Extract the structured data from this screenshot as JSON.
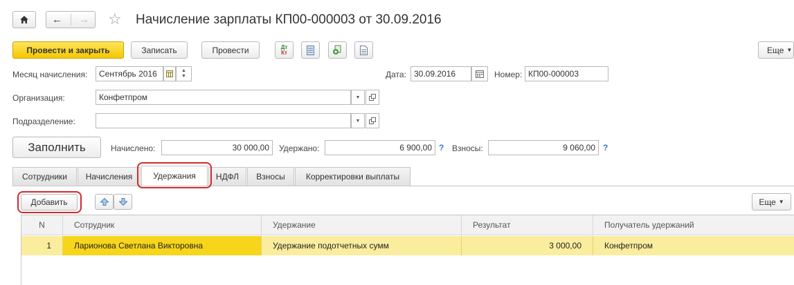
{
  "title": "Начисление зарплаты КП00-000003 от 30.09.2016",
  "toolbar": {
    "post_close": "Провести и закрыть",
    "save": "Записать",
    "post": "Провести",
    "more": "Еще"
  },
  "fields": {
    "month_label": "Месяц начисления:",
    "month_value": "Сентябрь 2016",
    "date_label": "Дата:",
    "date_value": "30.09.2016",
    "number_label": "Номер:",
    "number_value": "КП00-000003",
    "org_label": "Организация:",
    "org_value": "Конфетпром",
    "dept_label": "Подразделение:",
    "dept_value": ""
  },
  "summary": {
    "fill_button": "Заполнить",
    "accrued_label": "Начислено:",
    "accrued_value": "30 000,00",
    "withheld_label": "Удержано:",
    "withheld_value": "6 900,00",
    "contrib_label": "Взносы:",
    "contrib_value": "9 060,00",
    "help": "?"
  },
  "tabs": [
    {
      "label": "Сотрудники"
    },
    {
      "label": "Начисления"
    },
    {
      "label": "Удержания"
    },
    {
      "label": "НДФЛ"
    },
    {
      "label": "Взносы"
    },
    {
      "label": "Корректировки выплаты"
    }
  ],
  "active_tab": "Удержания",
  "grid_toolbar": {
    "add": "Добавить",
    "more": "Еще"
  },
  "table": {
    "columns": [
      "N",
      "Сотрудник",
      "Удержание",
      "Результат",
      "Получатель удержаний"
    ],
    "rows": [
      {
        "n": "1",
        "employee": "Ларионова Светлана Викторовна",
        "deduction": "Удержание подотчетных сумм",
        "result": "3 000,00",
        "recipient": "Конфетпром"
      }
    ]
  },
  "colors": {
    "accent_yellow": "#f5c800",
    "row_highlight": "#fbed9e",
    "cell_highlight": "#f7d51b",
    "annotation_red": "#d2282e",
    "help_blue": "#3a74c4"
  }
}
